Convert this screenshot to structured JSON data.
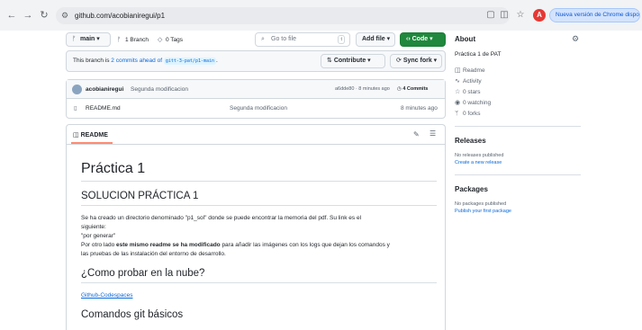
{
  "browser": {
    "url": "github.com/acobianiregui/p1",
    "update_chip": "Nueva versión de Chrome disponible",
    "profile_initial": "A"
  },
  "repo_bar": {
    "branch": "main",
    "branches": "1 Branch",
    "tags": "0 Tags",
    "go_to_file": "Go to file",
    "go_to_file_key": "t",
    "add_file": "Add file",
    "code": "Code"
  },
  "ahead": {
    "prefix": "This branch is ",
    "link": "2 commits ahead of",
    "branch": "gitt-3-pat/p1-main",
    "suffix": ".",
    "contribute": "Contribute",
    "sync_fork": "Sync fork"
  },
  "commit": {
    "author": "acobianiregui",
    "message": "Segunda modificacion",
    "hash_time": "a6dde80 · 8 minutes ago",
    "commits": "4 Commits"
  },
  "files": [
    {
      "name": "README.md",
      "message": "Segunda modificacion",
      "time": "8 minutes ago"
    }
  ],
  "readme": {
    "tab": "README",
    "h1": "Práctica 1",
    "h2_1": "SOLUCION PRÁCTICA 1",
    "p1": "Se ha creado un directorio denominado \"p1_sol\" donde se puede encontrar la memoria del pdf. Su link es el",
    "p2": "siguiente:",
    "p3": "\"por generar\"",
    "p4_pre": "Por otro lado ",
    "p4_bold": "este mismo readme se ha modificado",
    "p4_post": " para añadir las imágenes con los logs que dejan los comandos y",
    "p5": "las pruebas de las instalación del entorno de desarrollo.",
    "h2_2": "¿Como probar en la nube?",
    "link": "Github-Codespaces",
    "h2_3": "Comandos git básicos"
  },
  "about": {
    "title": "About",
    "description": "Práctica 1 de PAT",
    "readme": "Readme",
    "activity": "Activity",
    "stars": "0 stars",
    "watching": "0 watching",
    "forks": "0 forks"
  },
  "releases": {
    "title": "Releases",
    "none": "No releases published",
    "create": "Create a new release"
  },
  "packages": {
    "title": "Packages",
    "none": "No packages published",
    "publish": "Publish your first package"
  },
  "colors": {
    "accent_link": "#0969da",
    "code_green": "#1f883d",
    "profile_red": "#e53935"
  }
}
